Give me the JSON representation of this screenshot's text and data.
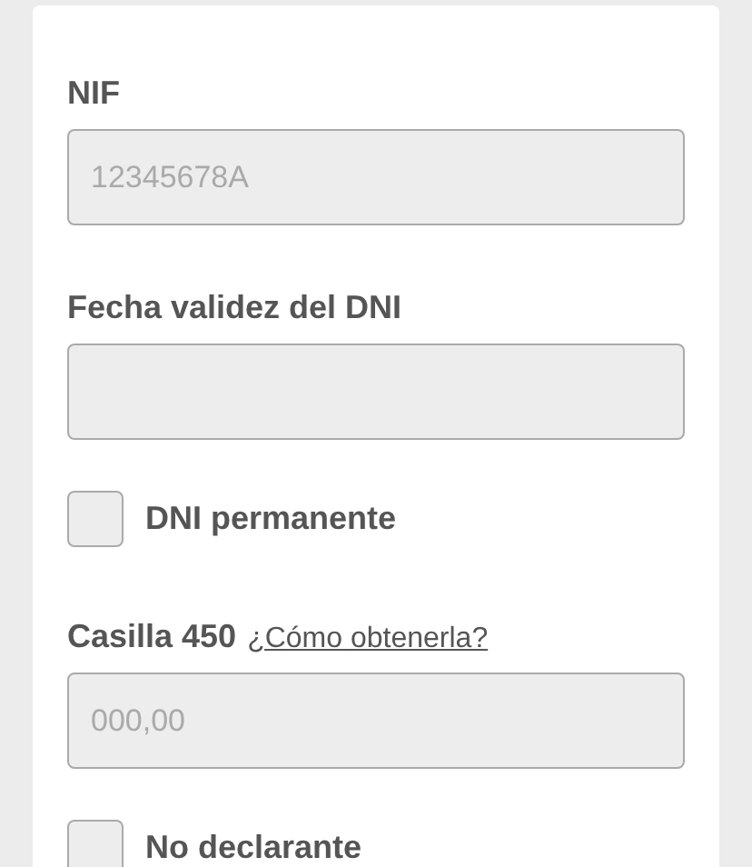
{
  "fields": [
    {
      "kind": "text",
      "label": "NIF",
      "placeholder": "12345678A"
    },
    {
      "kind": "text",
      "label": "Fecha validez del DNI"
    },
    {
      "kind": "checkbox",
      "label": "DNI permanente",
      "checked": false
    },
    {
      "kind": "text",
      "label": "Casilla 450",
      "link": "¿Cómo obtenerla?",
      "placeholder": "000,00"
    },
    {
      "kind": "checkbox",
      "label": "No declarante",
      "checked": false
    }
  ]
}
